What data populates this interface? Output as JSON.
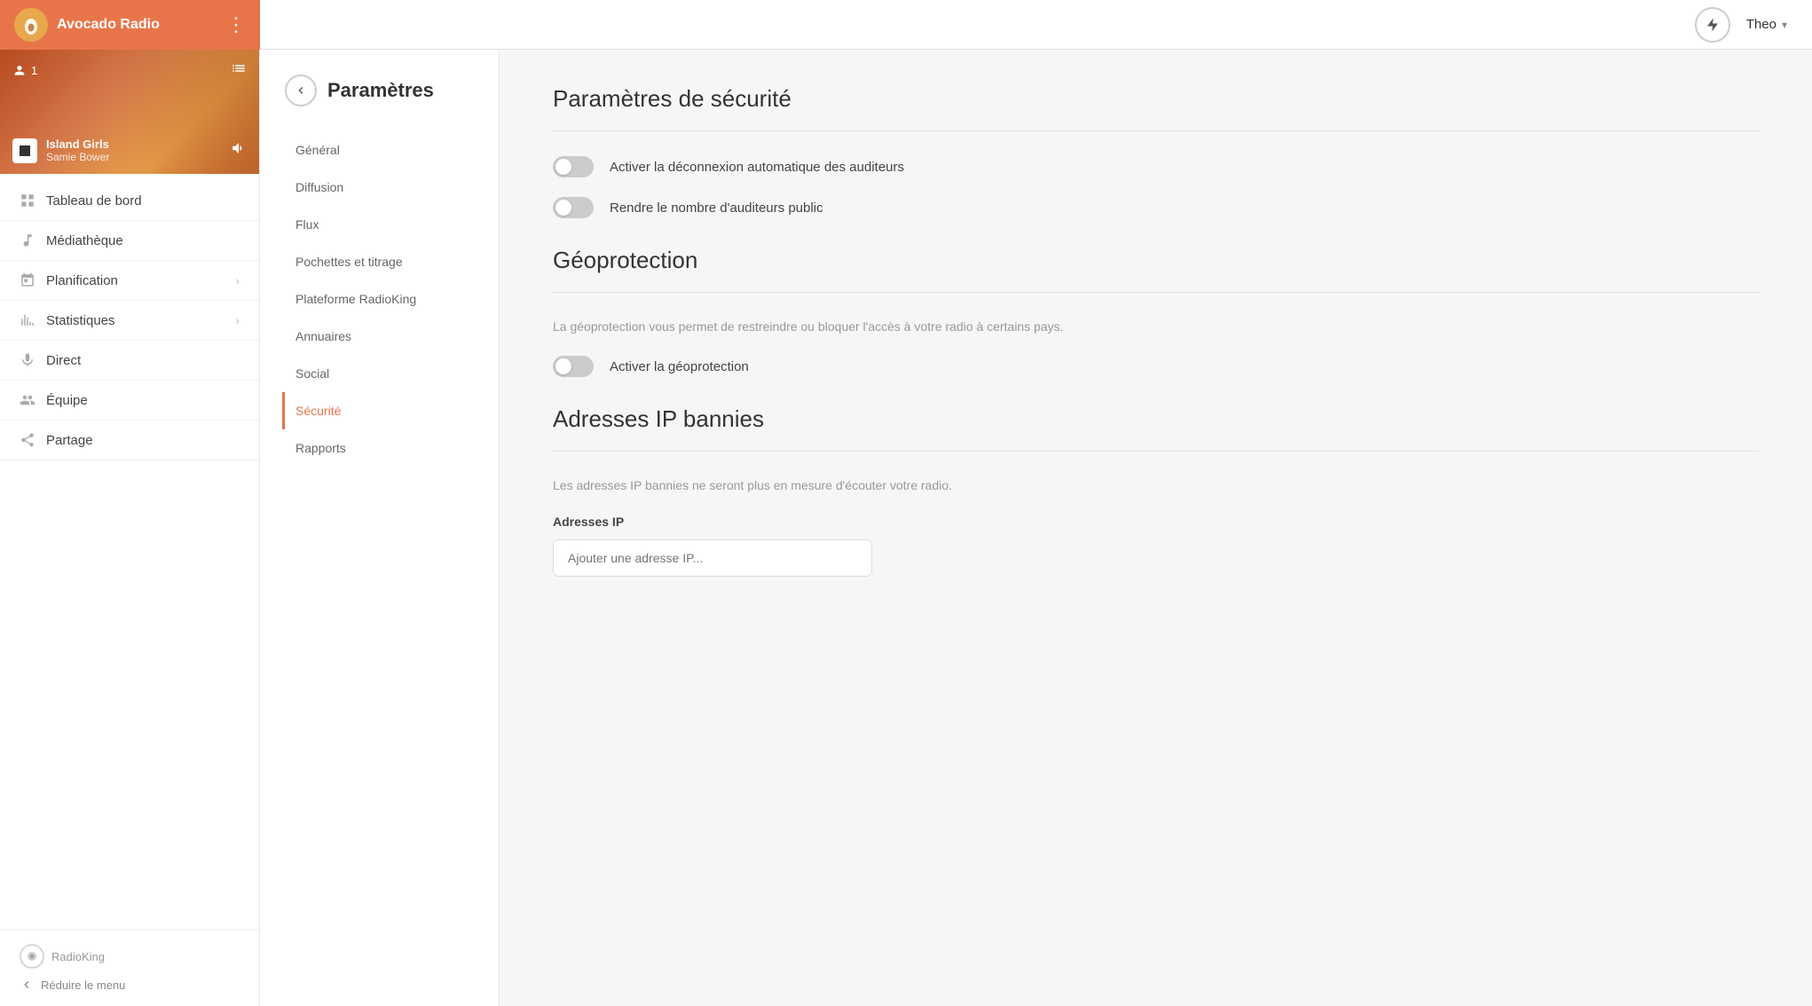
{
  "app": {
    "name": "Avocado Radio",
    "user": "Theo"
  },
  "header": {
    "bolt_label": "⚡",
    "user_label": "Theo",
    "chevron": "▾",
    "dots": "⋮"
  },
  "sidebar": {
    "cover": {
      "listeners_count": "1",
      "track_title": "Island Girls",
      "track_artist": "Samie Bower"
    },
    "nav_items": [
      {
        "id": "tableau",
        "label": "Tableau de bord",
        "icon": "dashboard"
      },
      {
        "id": "mediatheque",
        "label": "Médiathèque",
        "icon": "music"
      },
      {
        "id": "planification",
        "label": "Planification",
        "icon": "calendar",
        "has_chevron": true
      },
      {
        "id": "statistiques",
        "label": "Statistiques",
        "icon": "bar-chart",
        "has_chevron": true
      },
      {
        "id": "direct",
        "label": "Direct",
        "icon": "mic"
      },
      {
        "id": "equipe",
        "label": "Équipe",
        "icon": "team"
      },
      {
        "id": "partage",
        "label": "Partage",
        "icon": "share"
      }
    ],
    "footer": {
      "brand": "RadioKing",
      "reduce_label": "Réduire le menu"
    }
  },
  "settings_nav": {
    "title": "Paramètres",
    "items": [
      {
        "id": "general",
        "label": "Général",
        "active": false
      },
      {
        "id": "diffusion",
        "label": "Diffusion",
        "active": false
      },
      {
        "id": "flux",
        "label": "Flux",
        "active": false
      },
      {
        "id": "pochettes",
        "label": "Pochettes et titrage",
        "active": false
      },
      {
        "id": "plateforme",
        "label": "Plateforme RadioKing",
        "active": false
      },
      {
        "id": "annuaires",
        "label": "Annuaires",
        "active": false
      },
      {
        "id": "social",
        "label": "Social",
        "active": false
      },
      {
        "id": "securite",
        "label": "Sécurité",
        "active": true
      },
      {
        "id": "rapports",
        "label": "Rapports",
        "active": false
      }
    ]
  },
  "content": {
    "security_title": "Paramètres de sécurité",
    "toggle1_label": "Activer la déconnexion automatique des auditeurs",
    "toggle2_label": "Rendre le nombre d'auditeurs public",
    "geoprotection_title": "Géoprotection",
    "geoprotection_desc": "La géoprotection vous permet de restreindre ou bloquer l'accès à votre radio à certains pays.",
    "geoprotection_toggle_label": "Activer la géoprotection",
    "ip_ban_title": "Adresses IP bannies",
    "ip_ban_desc": "Les adresses IP bannies ne seront plus en mesure d'écouter votre radio.",
    "ip_field_label": "Adresses IP",
    "ip_field_placeholder": "Ajouter une adresse IP..."
  }
}
